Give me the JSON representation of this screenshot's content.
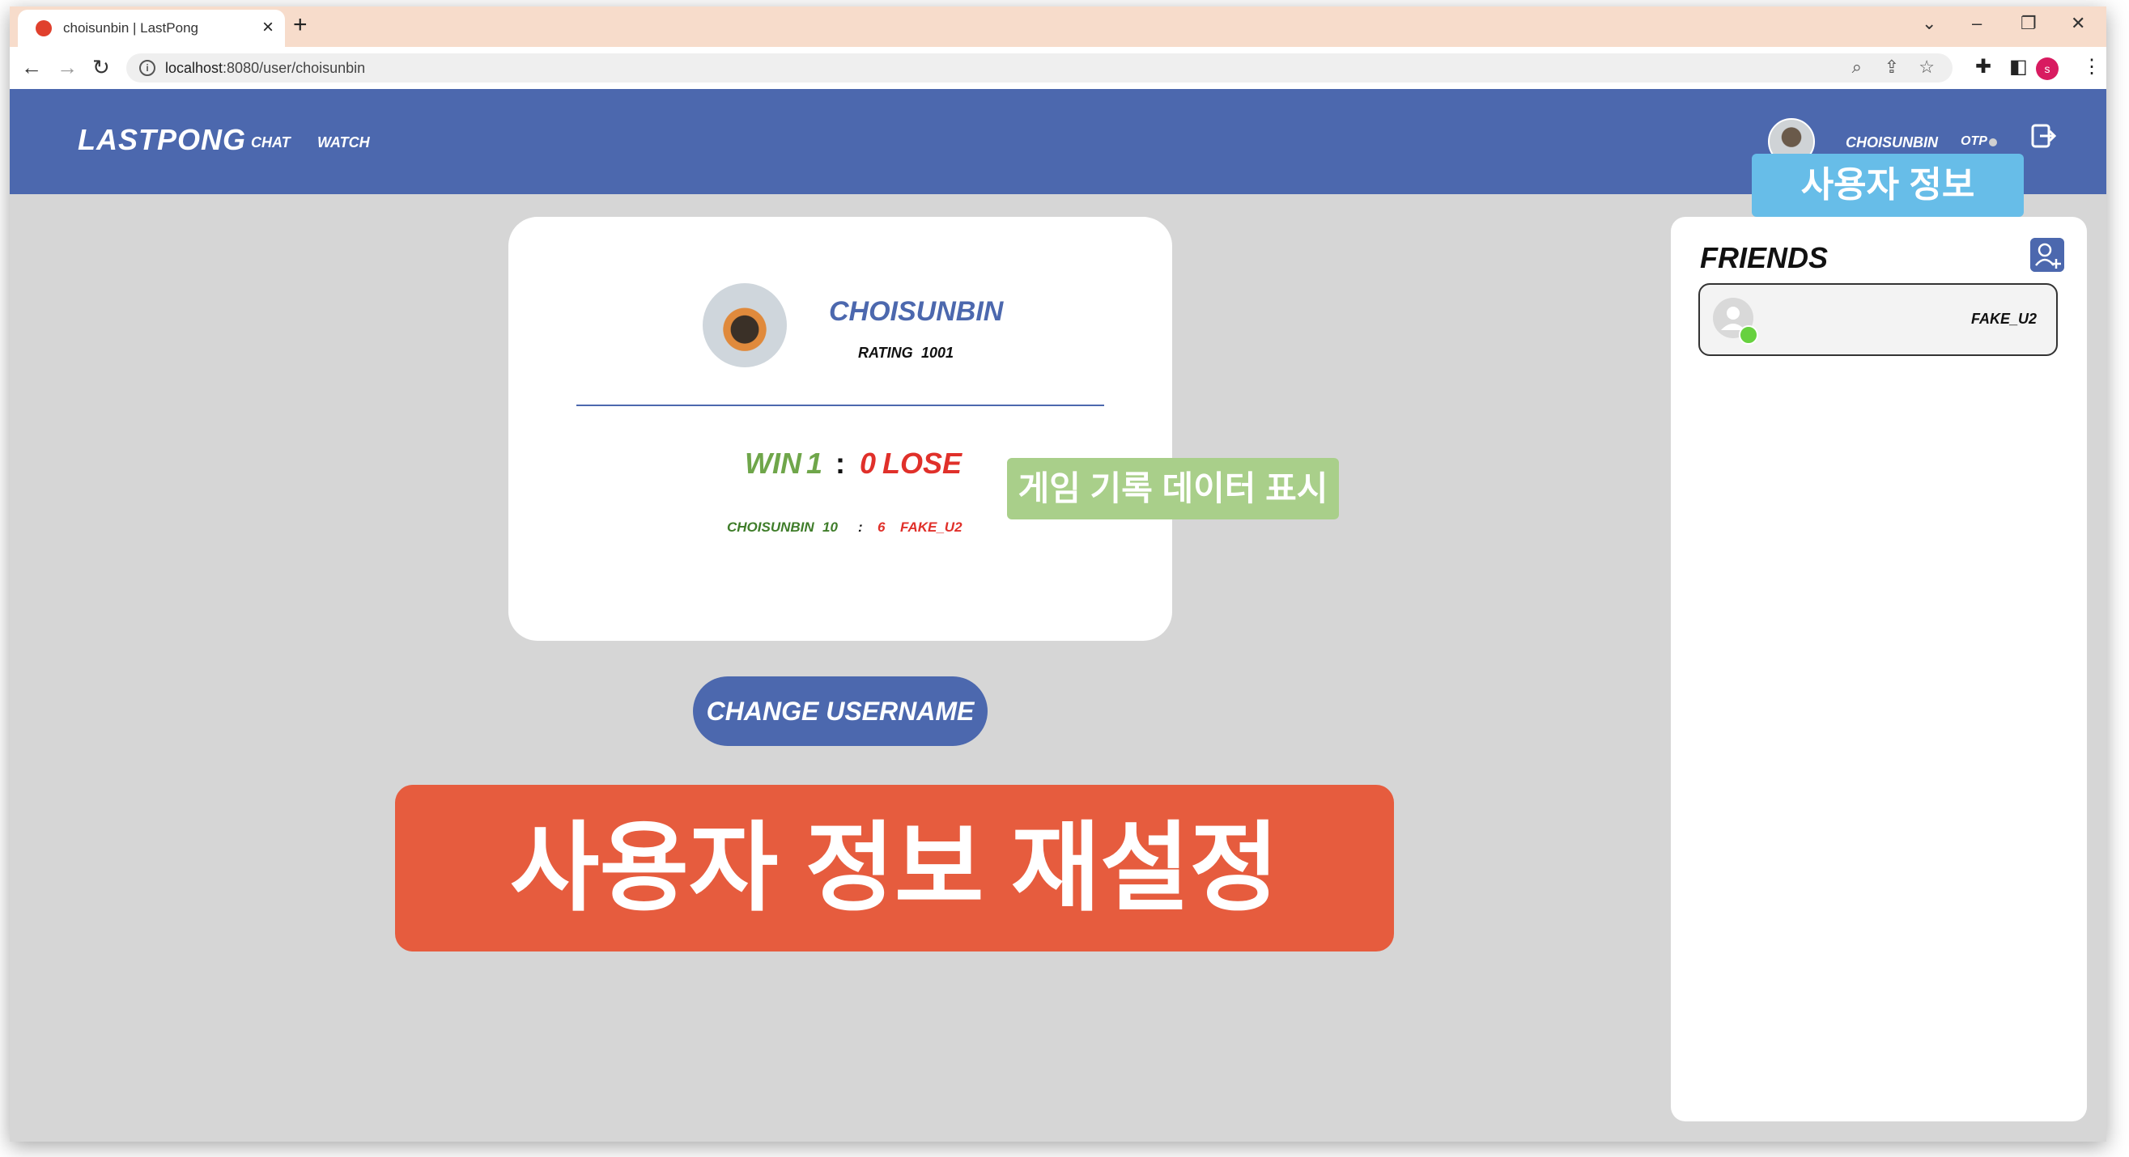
{
  "browser": {
    "tab_title": "choisunbin | LastPong",
    "new_tab": "+",
    "close_tab": "×",
    "url_host": "localhost",
    "url_path": ":8080/user/choisunbin",
    "profile_initial": "s"
  },
  "header": {
    "brand": "LASTPONG",
    "nav": [
      "CHAT",
      "WATCH"
    ],
    "username": "CHOISUNBIN",
    "otp_label": "OTP"
  },
  "annotations": {
    "user_info": "사용자 정보",
    "game_record": "게임 기록 데이터 표시",
    "reset_user_info": "사용자 정보 재설정"
  },
  "profile": {
    "username": "CHOISUNBIN",
    "rating_label": "RATING",
    "rating": "1001",
    "win_label": "WIN",
    "wins": "1",
    "separator": ":",
    "losses": "0",
    "lose_label": "LOSE",
    "last_match": {
      "player1": "CHOISUNBIN",
      "score1": "10",
      "separator": ":",
      "score2": "6",
      "player2": "FAKE_U2"
    },
    "change_username_label": "CHANGE USERNAME"
  },
  "friends": {
    "title": "FRIENDS",
    "items": [
      {
        "name": "FAKE_U2",
        "status": "online"
      }
    ]
  },
  "colors": {
    "header_bg": "#4c68ae",
    "win": "#6fa64a",
    "lose": "#e0302a",
    "online": "#67d13f",
    "tooltip_blue": "#67bde8",
    "tooltip_green": "#a9cf8a",
    "banner_red": "#e65c3e"
  },
  "icons": [
    "lastpong-favicon",
    "info-icon",
    "zoom-icon",
    "share-icon",
    "star-icon",
    "extensions-icon",
    "sidepanel-icon",
    "logout-icon",
    "add-friend-icon",
    "default-avatar-icon"
  ]
}
